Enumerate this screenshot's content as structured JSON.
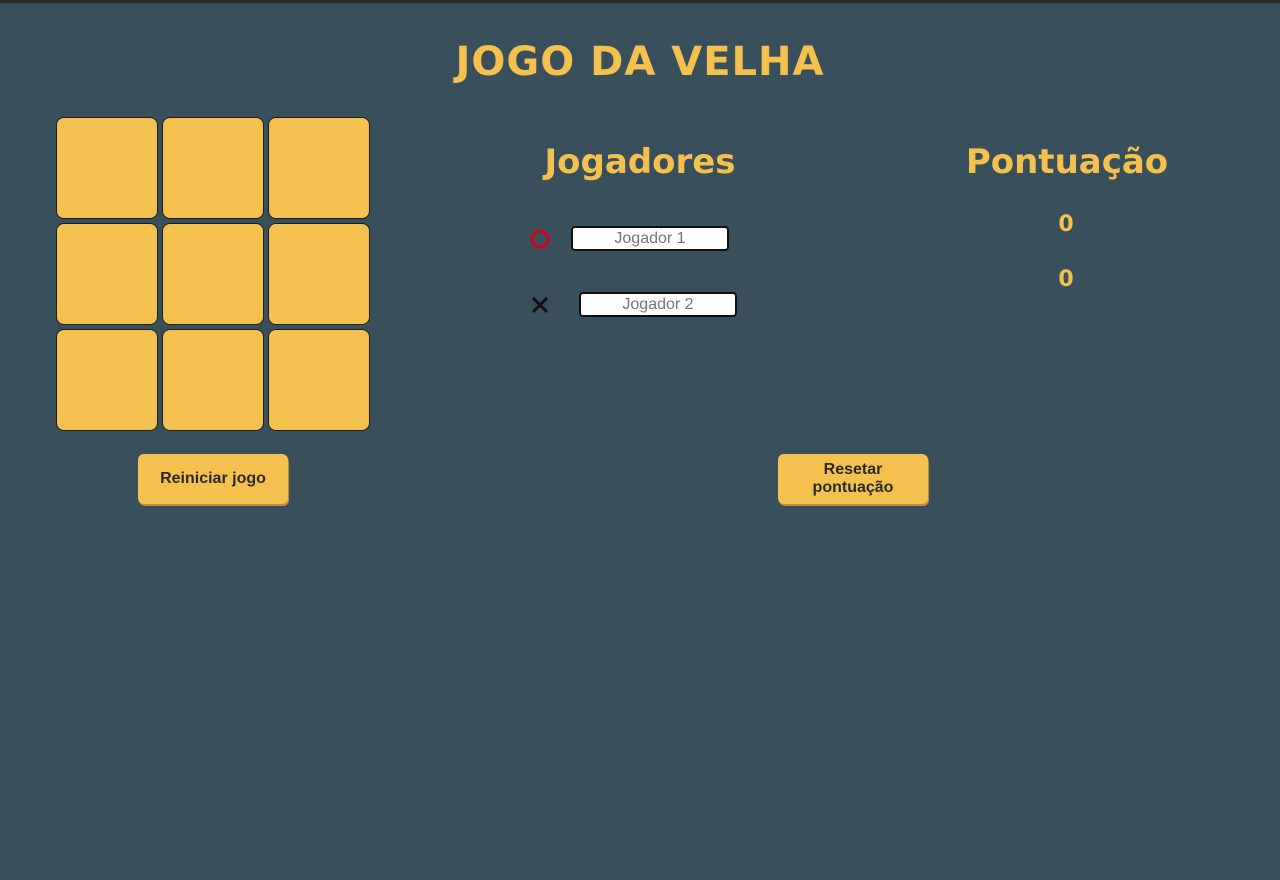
{
  "title": "JOGO DA VELHA",
  "board": {
    "cells": [
      "",
      "",
      "",
      "",
      "",
      "",
      "",
      "",
      ""
    ]
  },
  "players": {
    "heading": "Jogadores",
    "player1": {
      "symbol_icon": "circle-o-icon",
      "symbol_color": "#d0021b",
      "placeholder": "Jogador 1",
      "value": ""
    },
    "player2": {
      "symbol_icon": "cross-x-icon",
      "symbol_color": "#111111",
      "placeholder": "Jogador 2",
      "value": ""
    }
  },
  "score": {
    "heading": "Pontuação",
    "player1": "0",
    "player2": "0"
  },
  "buttons": {
    "restart": "Reiniciar jogo",
    "reset_score": "Resetar pontuação"
  },
  "colors": {
    "background": "#3a4f5c",
    "accent": "#f4c14e"
  }
}
